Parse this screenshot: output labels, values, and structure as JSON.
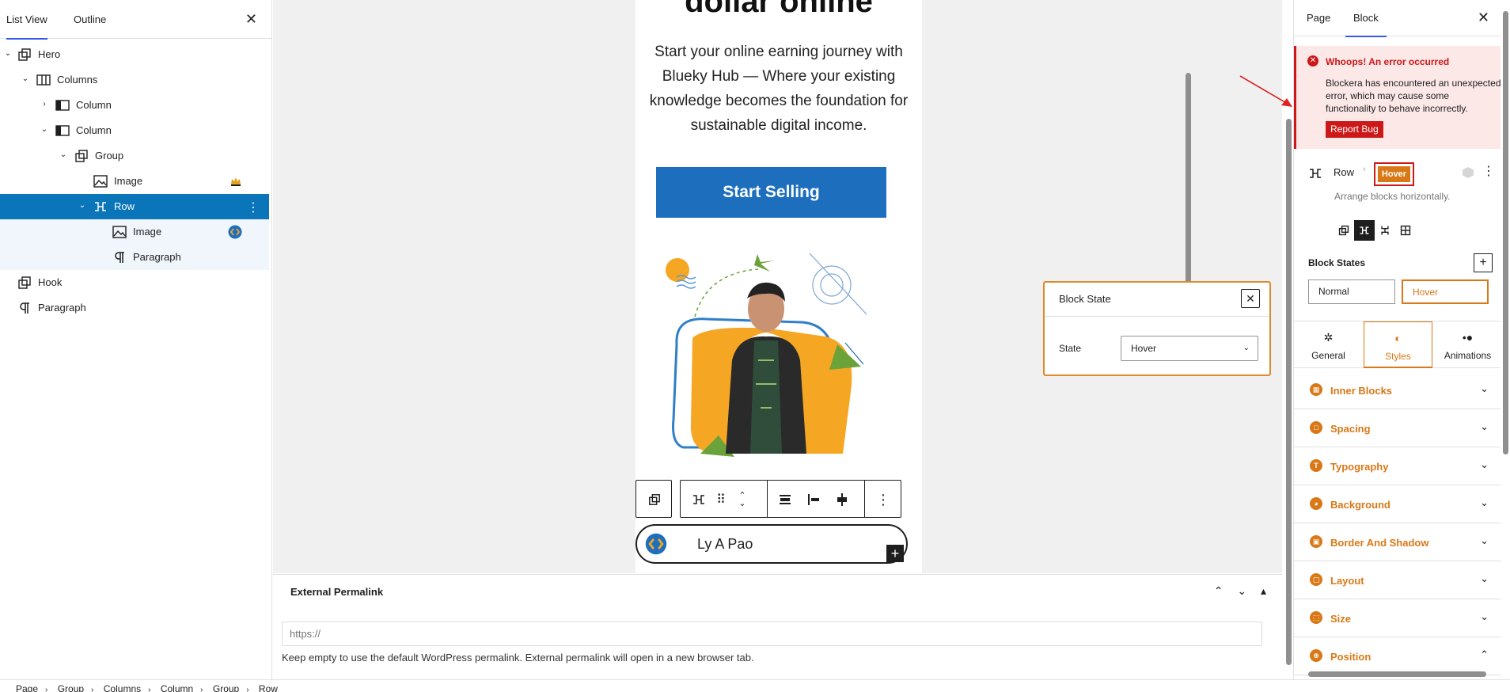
{
  "left_panel": {
    "tabs": [
      "List View",
      "Outline"
    ],
    "close": "✕",
    "tree": [
      {
        "label": "Hero",
        "icon": "group-icon"
      },
      {
        "label": "Columns",
        "icon": "columns-icon"
      },
      {
        "label": "Column",
        "icon": "column-icon"
      },
      {
        "label": "Column",
        "icon": "column-icon"
      },
      {
        "label": "Group",
        "icon": "group-icon"
      },
      {
        "label": "Image",
        "icon": "image-icon"
      },
      {
        "label": "Row",
        "icon": "row-icon"
      },
      {
        "label": "Image",
        "icon": "image-icon"
      },
      {
        "label": "Paragraph",
        "icon": "paragraph-icon"
      },
      {
        "label": "Hook",
        "icon": "group-icon"
      },
      {
        "label": "Paragraph",
        "icon": "paragraph-icon"
      }
    ]
  },
  "canvas": {
    "headline": "dollar online",
    "intro": "Start your online earning journey with Blueky Hub — Where your existing knowledge becomes the foundation for sustainable digital income.",
    "cta": "Start Selling",
    "author": "Ly A Pao"
  },
  "block_state_popup": {
    "title": "Block State",
    "state_label": "State",
    "state_value": "Hover"
  },
  "meta": {
    "title": "External Permalink",
    "placeholder": "https://",
    "help": "Keep empty to use the default WordPress permalink. External permalink will open in a new browser tab."
  },
  "breadcrumb": [
    "Page",
    "Group",
    "Columns",
    "Column",
    "Group",
    "Row"
  ],
  "right_panel": {
    "tabs": [
      "Page",
      "Block"
    ],
    "error": {
      "title": "Whoops! An error occurred",
      "text": "Blockera has encountered an unexpected error, which may cause some functionality to behave incorrectly.",
      "button": "Report Bug"
    },
    "block_name": "Row",
    "badge": "Hover",
    "description": "Arrange blocks horizontally.",
    "states_label": "Block States",
    "states": [
      "Normal",
      "Hover"
    ],
    "panel_tabs": [
      "General",
      "Styles",
      "Animations"
    ],
    "sections": [
      "Inner Blocks",
      "Spacing",
      "Typography",
      "Background",
      "Border And Shadow",
      "Layout",
      "Size",
      "Position"
    ]
  },
  "colors": {
    "accent": "#d97817",
    "selected": "#0a75b8",
    "error": "#cc1818",
    "cta": "#1d6fbe"
  }
}
